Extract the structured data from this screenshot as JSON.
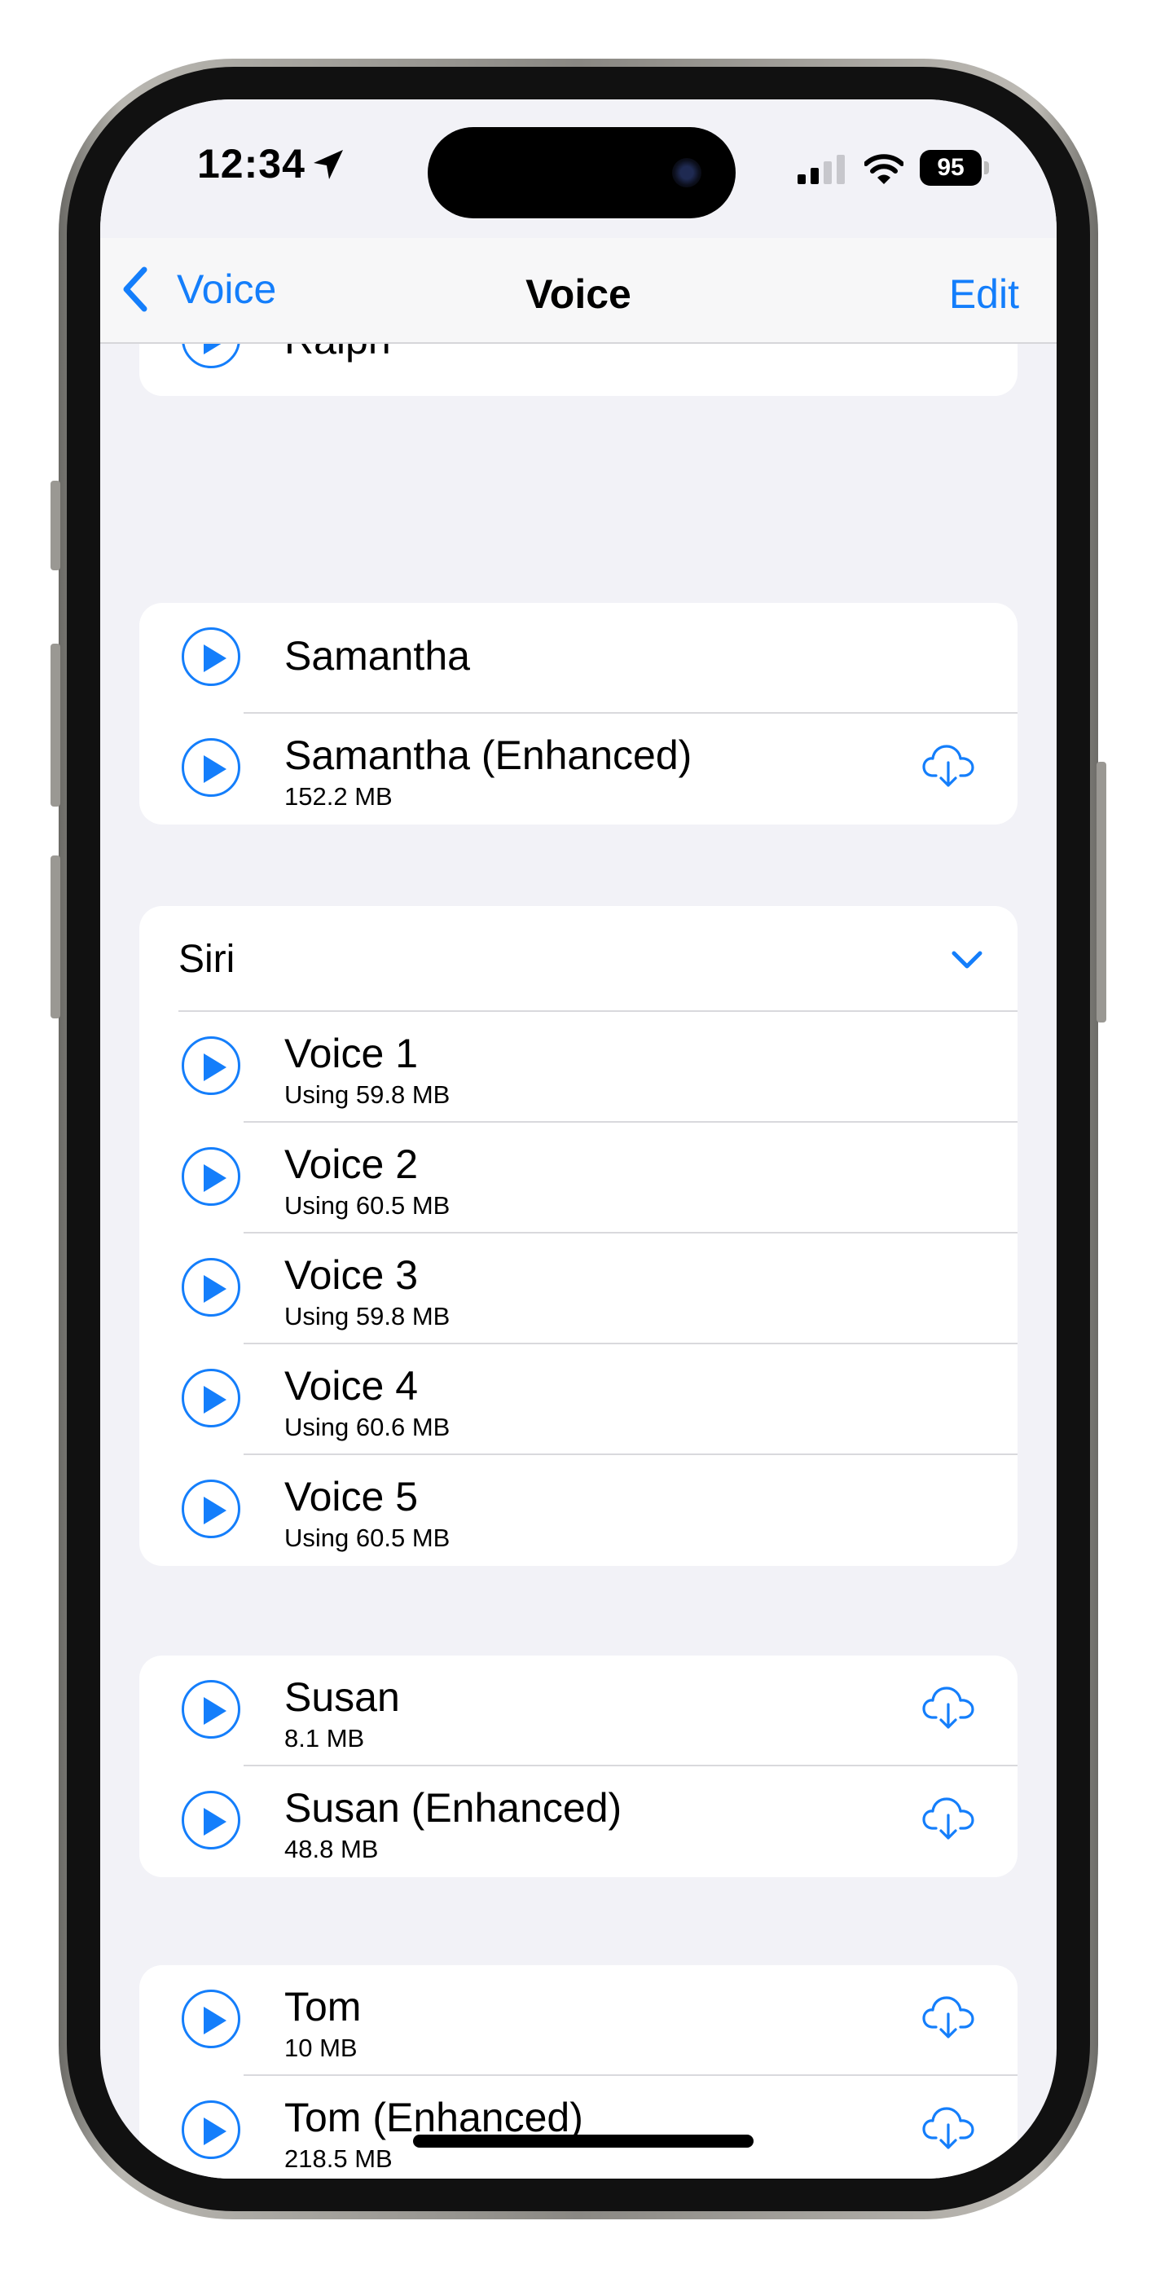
{
  "status": {
    "time": "12:34",
    "battery": "95"
  },
  "nav": {
    "back_label": "Voice",
    "title": "Voice",
    "edit_label": "Edit"
  },
  "ralph": {
    "name": "Ralph"
  },
  "samantha": {
    "items": [
      {
        "name": "Samantha"
      },
      {
        "name": "Samantha (Enhanced)",
        "size": "152.2 MB"
      }
    ]
  },
  "siri": {
    "label": "Siri",
    "items": [
      {
        "name": "Voice 1",
        "size": "Using 59.8 MB"
      },
      {
        "name": "Voice 2",
        "size": "Using 60.5 MB"
      },
      {
        "name": "Voice 3",
        "size": "Using 59.8 MB"
      },
      {
        "name": "Voice 4",
        "size": "Using 60.6 MB"
      },
      {
        "name": "Voice 5",
        "size": "Using 60.5 MB"
      }
    ]
  },
  "susan": {
    "items": [
      {
        "name": "Susan",
        "size": "8.1 MB"
      },
      {
        "name": "Susan (Enhanced)",
        "size": "48.8 MB"
      }
    ]
  },
  "tom": {
    "items": [
      {
        "name": "Tom",
        "size": "10 MB"
      },
      {
        "name": "Tom (Enhanced)",
        "size": "218.5 MB"
      }
    ]
  },
  "colors": {
    "accent": "#147efb",
    "background": "#f2f2f7",
    "card": "#ffffff"
  }
}
